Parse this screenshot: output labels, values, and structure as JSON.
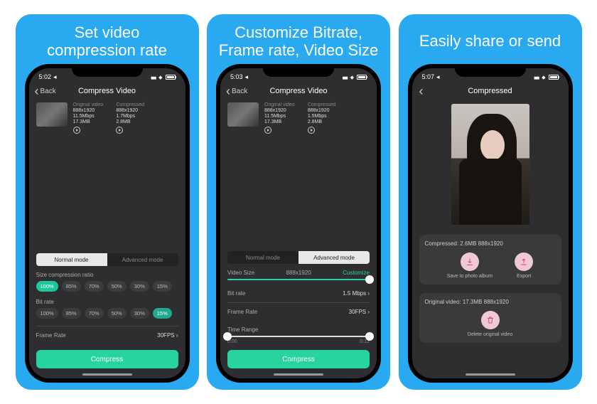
{
  "slides": [
    {
      "title": "Set video\ncompression rate"
    },
    {
      "title": "Customize Bitrate,\nFrame rate, Video Size"
    },
    {
      "title": "Easily share or send"
    }
  ],
  "status": {
    "time1": "5:02",
    "time2": "5:03",
    "time3": "5:07",
    "loc": "◂"
  },
  "header": {
    "back": "Back",
    "title12": "Compress Video",
    "title3": "Compressed"
  },
  "info": {
    "col_original": "Original video",
    "col_compressed": "Compressed",
    "res_original": "888x1920",
    "res_compressed": "888x1920",
    "bitrate_original": "11.5Mbps",
    "bitrate_compressed": "1.7Mbps",
    "size_original": "17.3MB",
    "size_compressed": "2.8MB",
    "bitrate_compressed_2": "1.5Mbps"
  },
  "modeTabs": {
    "normal": "Normal mode",
    "advanced": "Advanced mode"
  },
  "normalPanel": {
    "sizeLabel": "Size compression ratio",
    "sizePills": [
      "100%",
      "85%",
      "70%",
      "50%",
      "30%",
      "15%"
    ],
    "bitLabel": "Bit rate",
    "bitPills": [
      "100%",
      "85%",
      "70%",
      "50%",
      "30%",
      "15%"
    ],
    "frameRateLabel": "Frame Rate",
    "frameRateValue": "30FPS ›"
  },
  "advPanel": {
    "videoSizeLabel": "Video Size",
    "videoSizeValue": "888x1920",
    "videoSizeCustom": "Customize",
    "bitLabel": "Bit rate",
    "bitValue": "1.5 Mbps ›",
    "frameRateLabel": "Frame Rate",
    "frameRateValue": "30FPS ›",
    "timeRangeLabel": "Time Range",
    "timeStart": "0:00",
    "timeEnd": "0:12"
  },
  "cta": "Compress",
  "slide3": {
    "compressedLine": "Compressed:  2.6MB 888x1920",
    "originalLine": "Original video:  17.3MB 888x1920",
    "saveLabel": "Save to photo album",
    "exportLabel": "Export",
    "deleteLabel": "Delete original video"
  }
}
